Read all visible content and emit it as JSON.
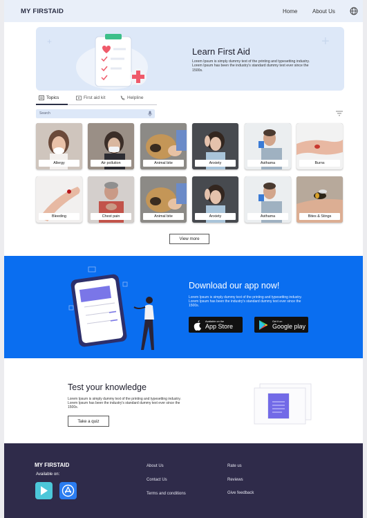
{
  "header": {
    "brand": "MY FIRSTAID",
    "nav": [
      "Home",
      "About Us"
    ],
    "globe_icon": "globe-icon"
  },
  "hero": {
    "title": "Learn First Aid",
    "text": "Lorem Ipsum is simply dummy text of the printing and typesetting industry. Lorem Ipsum has been the industry's standard dummy text ever since the 1500s."
  },
  "tabs": [
    {
      "label": "Topics",
      "icon": "topics-icon"
    },
    {
      "label": "First aid kit",
      "icon": "first-aid-kit-icon"
    },
    {
      "label": "Helpline",
      "icon": "phone-icon"
    }
  ],
  "search": {
    "placeholder": "Search"
  },
  "topics": [
    {
      "label": "Allergy"
    },
    {
      "label": "Air pollution"
    },
    {
      "label": "Animal bite"
    },
    {
      "label": "Anxiety"
    },
    {
      "label": "Asthama"
    },
    {
      "label": "Burns"
    },
    {
      "label": "Bleeding"
    },
    {
      "label": "Chest pain"
    },
    {
      "label": "Animal bite"
    },
    {
      "label": "Anxiety"
    },
    {
      "label": "Asthama"
    },
    {
      "label": "Bites & Stings"
    }
  ],
  "view_more": "View more",
  "app": {
    "title": "Download our app now!",
    "text": "Lorem Ipsum is simply dummy text of the printing and typesetting industry. Lorem Ipsum has been the industry's standard dummy text ever since the 1500s.",
    "appstore_small": "Available on the",
    "appstore_big": "App Store",
    "play_small": "Get it on",
    "play_big": "Google play"
  },
  "quiz": {
    "title": "Test your knowledge",
    "text": "Lorem Ipsum is simply dummy text of the printing and typesetting industry. Lorem Ipsum has been the industry's standard dummy text ever since the 1500s.",
    "button": "Take a quiz"
  },
  "footer": {
    "brand": "MY FIRSTAID",
    "available": "Available on:",
    "col1": [
      "About Us",
      "Contact Us",
      "Terms and conditions"
    ],
    "col2": [
      "Rate us",
      "Reviews",
      "Give feedback"
    ]
  },
  "colors": {
    "header_bg": "#e9eff9",
    "hero_bg": "#dde8f8",
    "app_band": "#0a6ef0",
    "footer_bg": "#2f2b4a"
  }
}
